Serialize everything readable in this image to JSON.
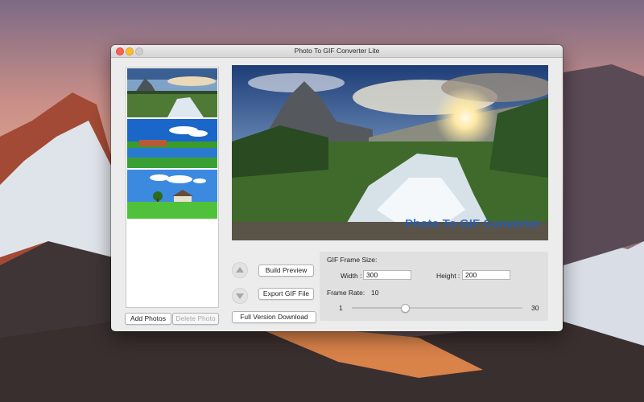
{
  "window": {
    "title": "Photo To GIF Converter Lite"
  },
  "photo_list": {
    "add_label": "Add  Photos",
    "delete_label": "Delete Photo"
  },
  "preview": {
    "watermark": "Photo To GIF Converter"
  },
  "actions": {
    "build_label": "Build Preview",
    "export_label": "Export GIF File",
    "full_version_label": "Full Version Download"
  },
  "settings": {
    "frame_size_label": "GIF Frame Size:",
    "width_label": "Width :",
    "width_value": "300",
    "height_label": "Height :",
    "height_value": "200",
    "frame_rate_label": "Frame Rate:",
    "frame_rate_value": "10",
    "slider_min": "1",
    "slider_max": "30"
  },
  "colors": {
    "close": "#fc5f57",
    "minimize": "#fdbc2e",
    "watermark": "#1f5fc0"
  }
}
